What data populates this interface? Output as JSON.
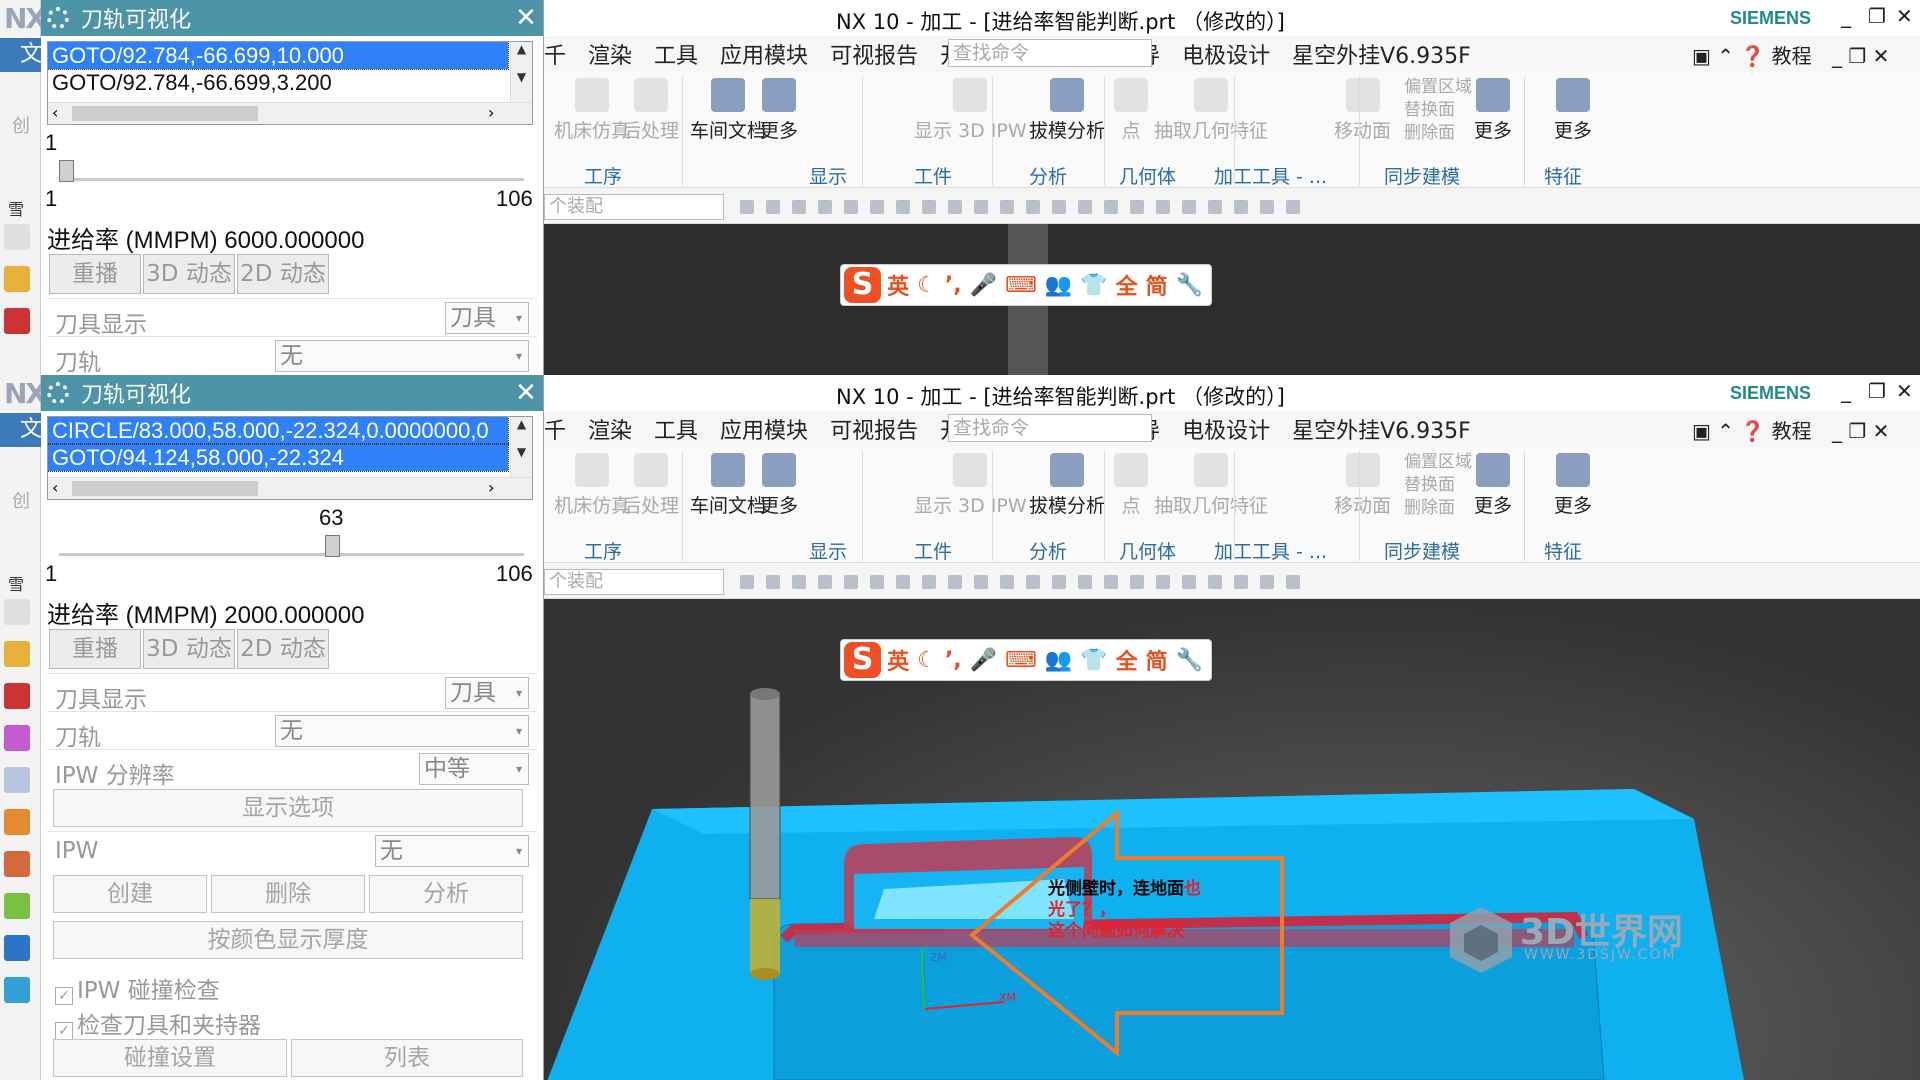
{
  "left_strip": {
    "logo": "NX",
    "file_tab": "文",
    "create_label": "创",
    "section_label": "雪"
  },
  "dialog": {
    "title": "刀轨可视化",
    "close": "✕"
  },
  "top": {
    "list": [
      "GOTO/92.784,-66.699,10.000",
      "GOTO/92.784,-66.699,3.200"
    ],
    "slider_value": "1",
    "slider_fraction": 0.0,
    "slider_min": "1",
    "slider_max": "106",
    "feed": "进给率 (MMPM) 6000.000000",
    "tabs": [
      "重播",
      "3D 动态",
      "2D 动态"
    ],
    "tool_display_label": "刀具显示",
    "tool_display_value": "刀具",
    "path_label": "刀轨",
    "path_value": "无"
  },
  "bottom": {
    "list": [
      "CIRCLE/83.000,58.000,-22.324,0.0000000,0",
      "GOTO/94.124,58.000,-22.324"
    ],
    "slider_value": "63",
    "slider_fraction": 0.59,
    "slider_min": "1",
    "slider_max": "106",
    "feed": "进给率 (MMPM) 2000.000000",
    "tabs": [
      "重播",
      "3D 动态",
      "2D 动态"
    ],
    "tool_display_label": "刀具显示",
    "tool_display_value": "刀具",
    "path_label": "刀轨",
    "path_value": "无",
    "ipw_res_label": "IPW 分辨率",
    "ipw_res_value": "中等",
    "display_options": "显示选项",
    "ipw_label": "IPW",
    "ipw_value": "无",
    "create": "创建",
    "delete": "删除",
    "analyze": "分析",
    "color_thickness": "按颜色显示厚度",
    "ipw_collision": "IPW 碰撞检查",
    "check_tool": "检查刀具和夹持器",
    "collision_settings": "碰撞设置",
    "list_btn": "列表"
  },
  "window": {
    "title": "NX 10 - 加工 - [进给率智能判断.prt （修改的）]",
    "brand": "SIEMENS",
    "menu": [
      "千",
      "渲染",
      "工具",
      "应用模块",
      "可视报告",
      "开发人员",
      "注塑模向导",
      "电极设计",
      "星空外挂V6.935F"
    ],
    "search_placeholder": "查找命令",
    "help": "教程"
  },
  "ribbon": {
    "buttons": [
      "机床仿真",
      "后处理",
      "车间文档",
      "更多",
      "显示 3D IPW",
      "拔模分析",
      "点",
      "抽取几何特征",
      "移动面",
      "更多",
      "更多"
    ],
    "small": [
      "偏置区域",
      "替换面",
      "删除面"
    ],
    "groups": [
      "工序",
      "显示",
      "工件",
      "分析",
      "几何体",
      "加工工具 - ...",
      "同步建模",
      "特征"
    ]
  },
  "toolbar2": {
    "assembly": "个装配"
  },
  "ime": {
    "items": [
      "英",
      "☾",
      "’,",
      "🎤",
      "⌨",
      "👥",
      "👕",
      "全",
      "简",
      "🔧"
    ]
  },
  "annotation": {
    "line1": "光侧壁时，连地面",
    "line1_red": "也",
    "line2": "光了？，",
    "line3": "这个问题如何解决"
  },
  "axes": {
    "z": "ZM",
    "x": "XM"
  },
  "watermark": {
    "brand": "3D世界网",
    "url": "WWW.3DSJW.COM"
  },
  "colors": {
    "part": "#0fb0f0",
    "dialog_header": "#4d94a8",
    "selection": "#2f81f7",
    "arrow": "#f07c2a",
    "note_red": "#e8202a"
  }
}
